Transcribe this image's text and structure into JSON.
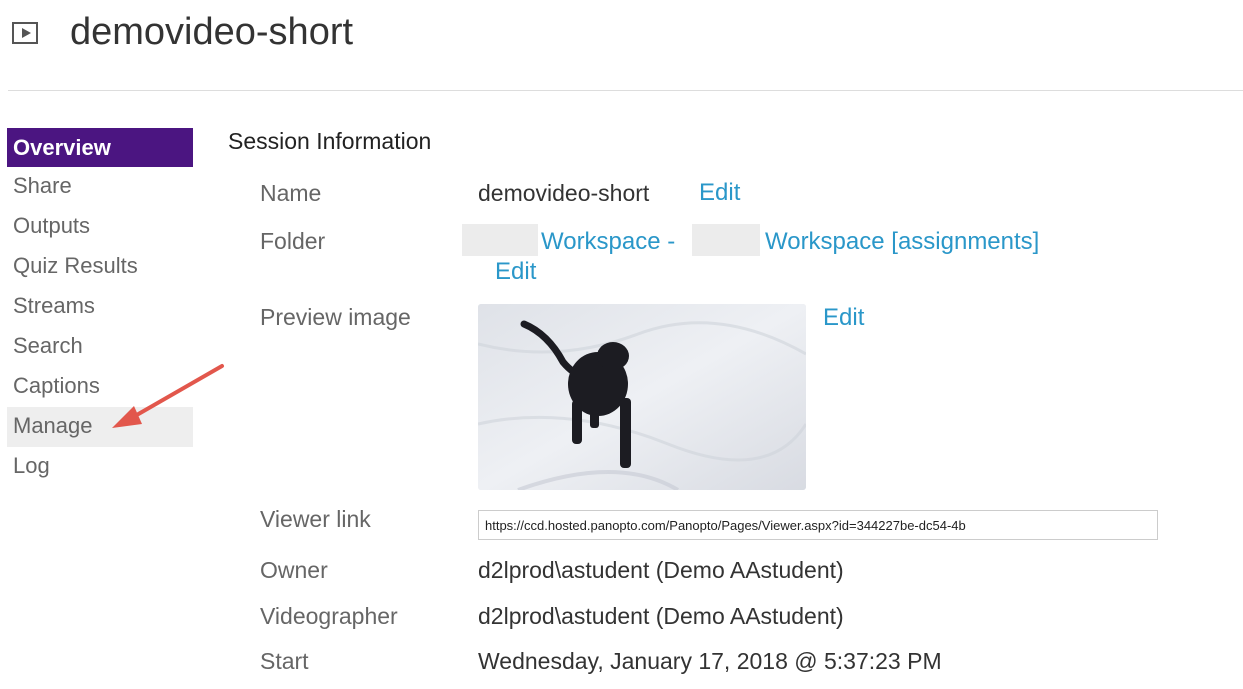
{
  "header": {
    "icon": "video-play-icon",
    "title": "demovideo-short"
  },
  "sidebar": {
    "items": [
      {
        "label": "Overview",
        "active": true
      },
      {
        "label": "Share"
      },
      {
        "label": "Outputs"
      },
      {
        "label": "Quiz Results"
      },
      {
        "label": "Streams"
      },
      {
        "label": "Search"
      },
      {
        "label": "Captions"
      },
      {
        "label": "Manage",
        "highlighted": true
      },
      {
        "label": "Log"
      }
    ],
    "active_color": "#4b1581"
  },
  "annotation": {
    "arrow_color": "#e2574c",
    "points_to": "Manage"
  },
  "session": {
    "section_title": "Session Information",
    "name": {
      "label": "Name",
      "value": "demovideo-short",
      "edit_label": "Edit"
    },
    "folder": {
      "label": "Folder",
      "part1": "Workspace -",
      "part2": "Workspace [assignments]",
      "edit_label": "Edit"
    },
    "preview": {
      "label": "Preview image",
      "edit_label": "Edit"
    },
    "viewer_link": {
      "label": "Viewer link",
      "value": "https://ccd.hosted.panopto.com/Panopto/Pages/Viewer.aspx?id=344227be-dc54-4b"
    },
    "owner": {
      "label": "Owner",
      "value": "d2lprod\\astudent (Demo AAstudent)"
    },
    "videographer": {
      "label": "Videographer",
      "value": "d2lprod\\astudent (Demo AAstudent)"
    },
    "start": {
      "label": "Start",
      "value": "Wednesday, January 17, 2018 @ 5:37:23 PM"
    }
  },
  "link_color": "#2a97c9"
}
